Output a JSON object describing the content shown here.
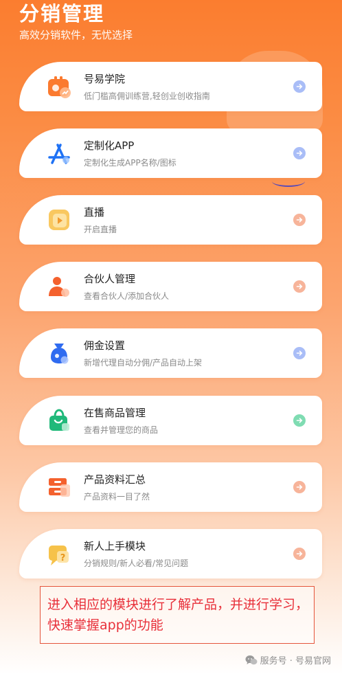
{
  "header": {
    "title": "分销管理",
    "subtitle": "高效分销软件，无忧选择"
  },
  "cards": [
    {
      "title": "号易学院",
      "subtitle": "低门槛高佣训练营,轻创业创收指南",
      "icon": "academy-icon",
      "arrow_color": "#a9bdf7"
    },
    {
      "title": "定制化APP",
      "subtitle": "定制化生成APP名称/图标",
      "icon": "app-store-icon",
      "arrow_color": "#a9bdf7"
    },
    {
      "title": "直播",
      "subtitle": "开启直播",
      "icon": "live-stream-icon",
      "arrow_color": "#f7b49a"
    },
    {
      "title": "合伙人管理",
      "subtitle": "查看合伙人/添加合伙人",
      "icon": "partner-icon",
      "arrow_color": "#f7b49a"
    },
    {
      "title": "佣金设置",
      "subtitle": "新增代理自动分佣/产品自动上架",
      "icon": "money-bag-icon",
      "arrow_color": "#a9bdf7"
    },
    {
      "title": "在售商品管理",
      "subtitle": "查看并管理您的商品",
      "icon": "shopping-bag-icon",
      "arrow_color": "#7fdcb2"
    },
    {
      "title": "产品资料汇总",
      "subtitle": "产品资料一目了然",
      "icon": "product-docs-icon",
      "arrow_color": "#f7b49a"
    },
    {
      "title": "新人上手模块",
      "subtitle": "分销规则/新人必看/常见问题",
      "icon": "help-question-icon",
      "arrow_color": "#f7b49a"
    }
  ],
  "annotation": {
    "text": "进入相应的模块进行了解产品，并进行学习，快速掌握app的功能",
    "color": "#e8303a"
  },
  "footer": {
    "text": "服务号 · 号易官网",
    "icon": "wechat-icon"
  },
  "colors": {
    "brand_orange": "#fb7d2f",
    "arrow_blue": "#a9bdf7",
    "arrow_peach": "#f7b49a",
    "arrow_green": "#7fdcb2"
  }
}
